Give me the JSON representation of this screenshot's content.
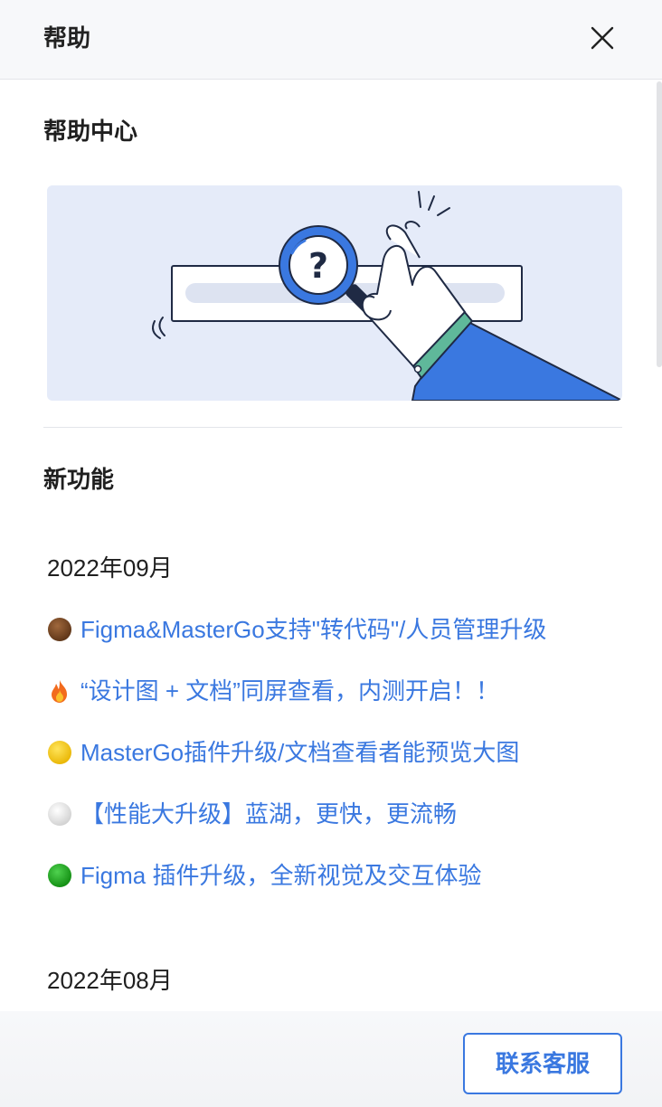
{
  "header": {
    "title": "帮助",
    "close_icon": "close-icon"
  },
  "help_center": {
    "title": "帮助中心",
    "banner_illustration": "magnifier-search-illustration"
  },
  "features": {
    "title": "新功能",
    "months": [
      {
        "label": "2022年09月",
        "items": [
          {
            "icon": "brown-circle-icon",
            "color": "#7a4a26",
            "text": "Figma&MasterGo支持\"转代码\"/人员管理升级"
          },
          {
            "icon": "fire-icon",
            "color": "#f5821f",
            "text": "“设计图 + 文档”同屏查看，内测开启！！"
          },
          {
            "icon": "yellow-circle-icon",
            "color": "#f7d11e",
            "text": "MasterGo插件升级/文档查看者能预览大图"
          },
          {
            "icon": "white-circle-icon",
            "color": "#e6e6e6",
            "text": "【性能大升级】蓝湖，更快，更流畅"
          },
          {
            "icon": "green-circle-icon",
            "color": "#1fa91f",
            "text": "Figma 插件升级，全新视觉及交互体验"
          }
        ]
      },
      {
        "label": "2022年08月",
        "items": []
      }
    ]
  },
  "footer": {
    "contact_label": "联系客服"
  },
  "colors": {
    "link": "#3a78e0",
    "header_bg": "#f7f8fa",
    "banner_bg": "#e5ebf9"
  }
}
